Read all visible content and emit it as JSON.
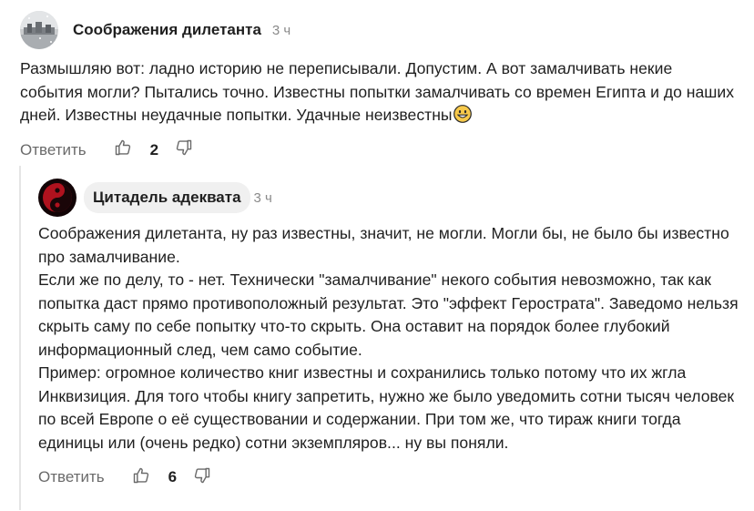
{
  "comments": [
    {
      "author": "Соображения дилетанта",
      "time": "3 ч",
      "text": "Размышляю вот: ладно историю не переписывали. Допустим. А вот замалчивать некие события могли? Пытались точно. Известны попытки замалчивать со времен Египта и до наших дней. Известны неудачные попытки. Удачные неизвестны",
      "emoji_icon": "grinning-face-emoji",
      "reply_label": "Ответить",
      "likes": "2"
    },
    {
      "author": "Цитадель адеквата",
      "time": "3 ч",
      "text": "Соображения дилетанта, ну раз известны, значит, не могли. Могли бы, не было бы известно про замалчивание.\nЕсли же по делу, то - нет. Технически \"замалчивание\" некого события невозможно, так как попытка даст прямо противоположный результат. Это \"эффект Герострата\". Заведомо нельзя скрыть саму по себе попытку что-то скрыть. Она оставит на порядок более глубокий информационный след, чем само событие.\nПример: огромное количество книг известны и сохранились только потому что их жгла Инквизиция. Для того чтобы книгу запретить, нужно же было уведомить сотни тысяч человек по всей Европе о её существовании и содержании. При том же, что тираж книги тогда единицы или (очень редко) сотни экземпляров... ну вы поняли.",
      "reply_label": "Ответить",
      "likes": "6"
    }
  ],
  "colors": {
    "text": "#1f1f1f",
    "muted": "#8a8a8a",
    "action": "#6a6a6a",
    "author_chip": "#f0f0f0",
    "thread_line": "#e5e5e5"
  }
}
